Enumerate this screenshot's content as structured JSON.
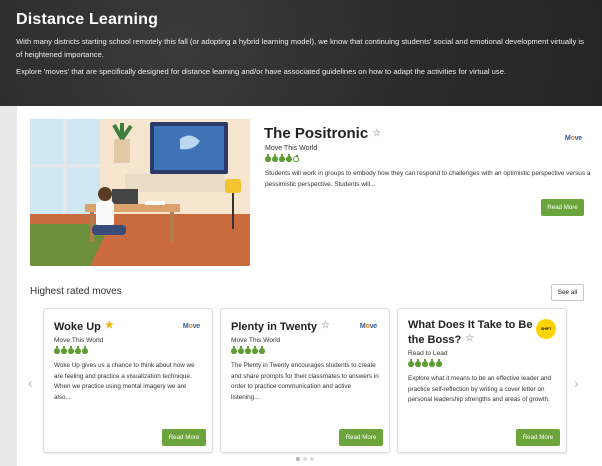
{
  "banner": {
    "title": "Distance Learning",
    "paragraph1": "With many districts starting school remotely this fall (or adopting a hybrid learning model), we know that continuing students' social and emotional development virtually is of heightened importance.",
    "paragraph2": "Explore 'moves' that are specifically designed for distance learning and/or have associated guidelines on how to adapt the activities for virtual use."
  },
  "featured": {
    "title": "The Positronic",
    "provider": "Move This World",
    "rating": 4,
    "rating_max": 5,
    "description": "Students will work in groups to embody how they can respond to challenges with an optimistic perspective versus a pessimistic perspective. Students will...",
    "button": "Read More",
    "logo_icon": "move-this-world-logo"
  },
  "highest_rated": {
    "heading": "Highest rated moves",
    "see_all": "See all",
    "cards": [
      {
        "title": "Woke Up",
        "favorited": true,
        "provider": "Move This World",
        "rating": 5,
        "description": "Woke Up gives us a chance to think about how we are feeling and practice a visualization technique. When we practice using mental imagery we are also...",
        "button": "Read More",
        "logo_icon": "move-this-world-logo"
      },
      {
        "title": "Plenty in Twenty",
        "favorited": false,
        "provider": "Move This World",
        "rating": 5,
        "description": "The Plenty in Twenty encourages students to create and share prompts for their classmates to answers in order to practice communication and active listening...",
        "button": "Read More",
        "logo_icon": "move-this-world-logo"
      },
      {
        "title": "What Does It Take to Be the Boss?",
        "favorited": false,
        "provider": "Read to Lead",
        "rating": 5,
        "description": "Explore what it means to be an effective leader and practice self-reflection by writing a cover letter on personal leadership strengths and areas of growth.",
        "button": "Read More",
        "logo_icon": "read-to-lead-logo"
      }
    ],
    "carousel_pages": 3,
    "carousel_active": 1
  },
  "colors": {
    "accent": "#6aa43b",
    "star": "#f4b400",
    "banner_bg": "#2e2e2e"
  }
}
